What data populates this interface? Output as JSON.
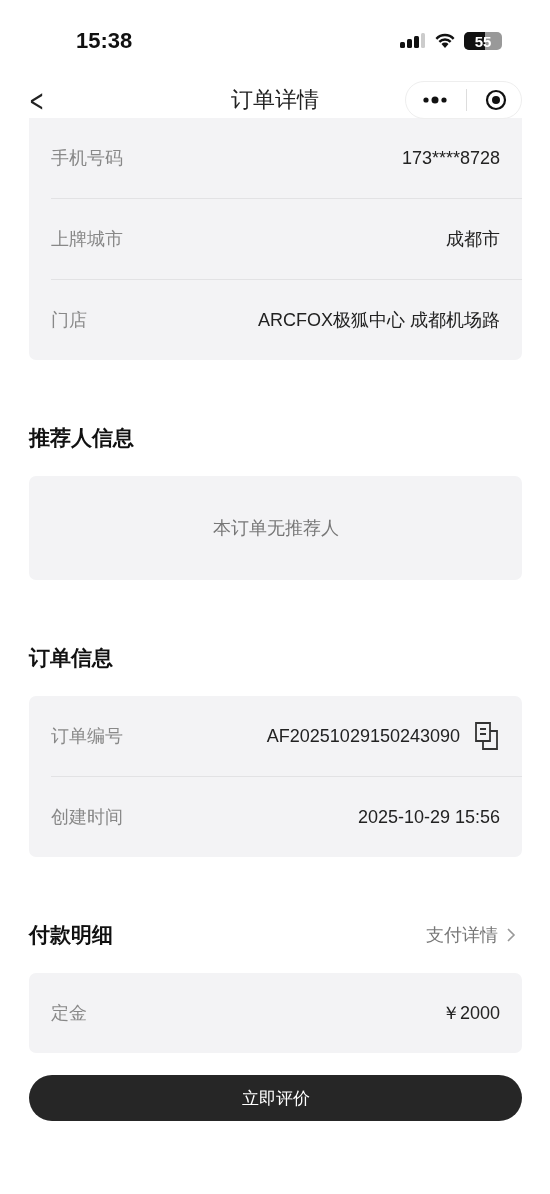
{
  "status_bar": {
    "time": "15:38",
    "battery": "55"
  },
  "nav": {
    "back": "<",
    "title": "订单详情"
  },
  "sections": [
    {
      "kind": "rows",
      "rows": [
        {
          "label": "手机号码",
          "value": "173****8728",
          "copy": false
        },
        {
          "label": "上牌城市",
          "value": "成都市",
          "copy": false
        },
        {
          "label": "门店",
          "value": "ARCFOX极狐中心 成都机场路",
          "copy": false
        }
      ]
    },
    {
      "kind": "empty",
      "title": "推荐人信息",
      "message": "本订单无推荐人"
    },
    {
      "kind": "rows",
      "title": "订单信息",
      "rows": [
        {
          "label": "订单编号",
          "value": "AF20251029150243090",
          "copy": true
        },
        {
          "label": "创建时间",
          "value": "2025-10-29 15:56",
          "copy": false
        }
      ]
    },
    {
      "kind": "rows",
      "title": "付款明细",
      "link": "支付详情",
      "rows": [
        {
          "label": "定金",
          "value": "￥2000",
          "copy": false
        }
      ]
    }
  ],
  "button": "立即评价"
}
